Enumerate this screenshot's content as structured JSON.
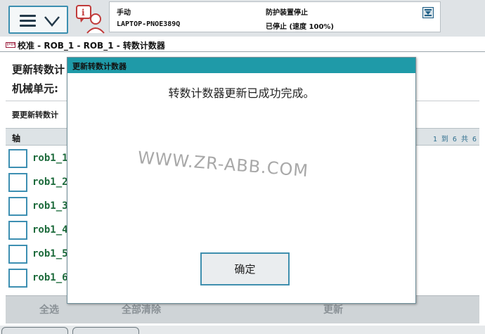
{
  "status": {
    "mode": "手动",
    "host": "LAPTOP-PNOE389Q",
    "guard": "防护装置停止",
    "speed": "已停止 (速度 100%)"
  },
  "breadcrumb": {
    "text": "校准 - ROB_1 - ROB_1 - 转数计数器",
    "icon": "calibration-icon"
  },
  "page": {
    "title": "更新转数计",
    "unit": "机械单元:",
    "instruction": "要更新转数计"
  },
  "table": {
    "header_axis": "轴",
    "header_count": "1 到 6 共 6",
    "rows": [
      {
        "label": "rob1_1"
      },
      {
        "label": "rob1_2"
      },
      {
        "label": "rob1_3"
      },
      {
        "label": "rob1_4"
      },
      {
        "label": "rob1_5"
      },
      {
        "label": "rob1_6"
      }
    ]
  },
  "actions": {
    "select_all": "全选",
    "clear_all": "全部清除",
    "update": "更新"
  },
  "dialog": {
    "title": "更新转数计数器",
    "message": "转数计数器更新已成功完成。",
    "ok": "确定"
  },
  "watermark": "WWW.ZR-ABB.COM",
  "colors": {
    "accent": "#1f9aa8",
    "border_blue": "#3d8fb2",
    "axis_label_green": "#1d6b3c"
  }
}
